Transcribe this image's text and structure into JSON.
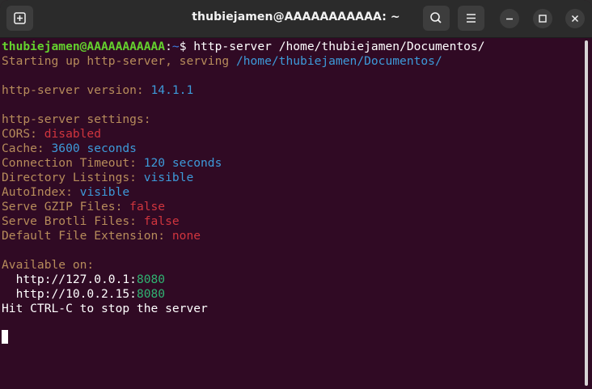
{
  "window": {
    "title": "thubiejamen@AAAAAAAAAAA: ~"
  },
  "titlebar": {
    "icons": {
      "new_tab": "new-tab-icon",
      "search": "search-icon",
      "menu": "hamburger-menu-icon",
      "minimize": "minimize-icon",
      "maximize": "maximize-icon",
      "close": "close-icon"
    }
  },
  "terminal": {
    "colors": {
      "background": "#300a24",
      "text": "#ffffff",
      "tan": "#b78c5b",
      "blue": "#3d9ad9",
      "red": "#d0353e",
      "green": "#2fb372",
      "prompt_user": "#64d12e",
      "prompt_path": "#3d7ce0"
    },
    "prompt": {
      "user_host": "thubiejamen@AAAAAAAAAAA",
      "separator": ":",
      "path": "~",
      "symbol": "$ ",
      "command": "http-server /home/thubiejamen/Documentos/"
    },
    "startup": {
      "prefix": "Starting up http-server, serving ",
      "path": "/home/thubiejamen/Documentos/"
    },
    "version": {
      "label": "http-server version: ",
      "value": "14.1.1"
    },
    "settings_header": "http-server settings:",
    "settings": [
      {
        "label": "CORS: ",
        "value": "disabled"
      },
      {
        "label": "Cache: ",
        "value": "3600 seconds"
      },
      {
        "label": "Connection Timeout: ",
        "value": "120 seconds"
      },
      {
        "label": "Directory Listings: ",
        "value": "visible"
      },
      {
        "label": "AutoIndex: ",
        "value": "visible"
      },
      {
        "label": "Serve GZIP Files: ",
        "value": "false"
      },
      {
        "label": "Serve Brotli Files: ",
        "value": "false"
      },
      {
        "label": "Default File Extension: ",
        "value": "none"
      }
    ],
    "available_header": "Available on:",
    "addresses": [
      {
        "host": "  http://127.0.0.1:",
        "port": "8080"
      },
      {
        "host": "  http://10.0.2.15:",
        "port": "8080"
      }
    ],
    "stop_hint": "Hit CTRL-C to stop the server"
  }
}
